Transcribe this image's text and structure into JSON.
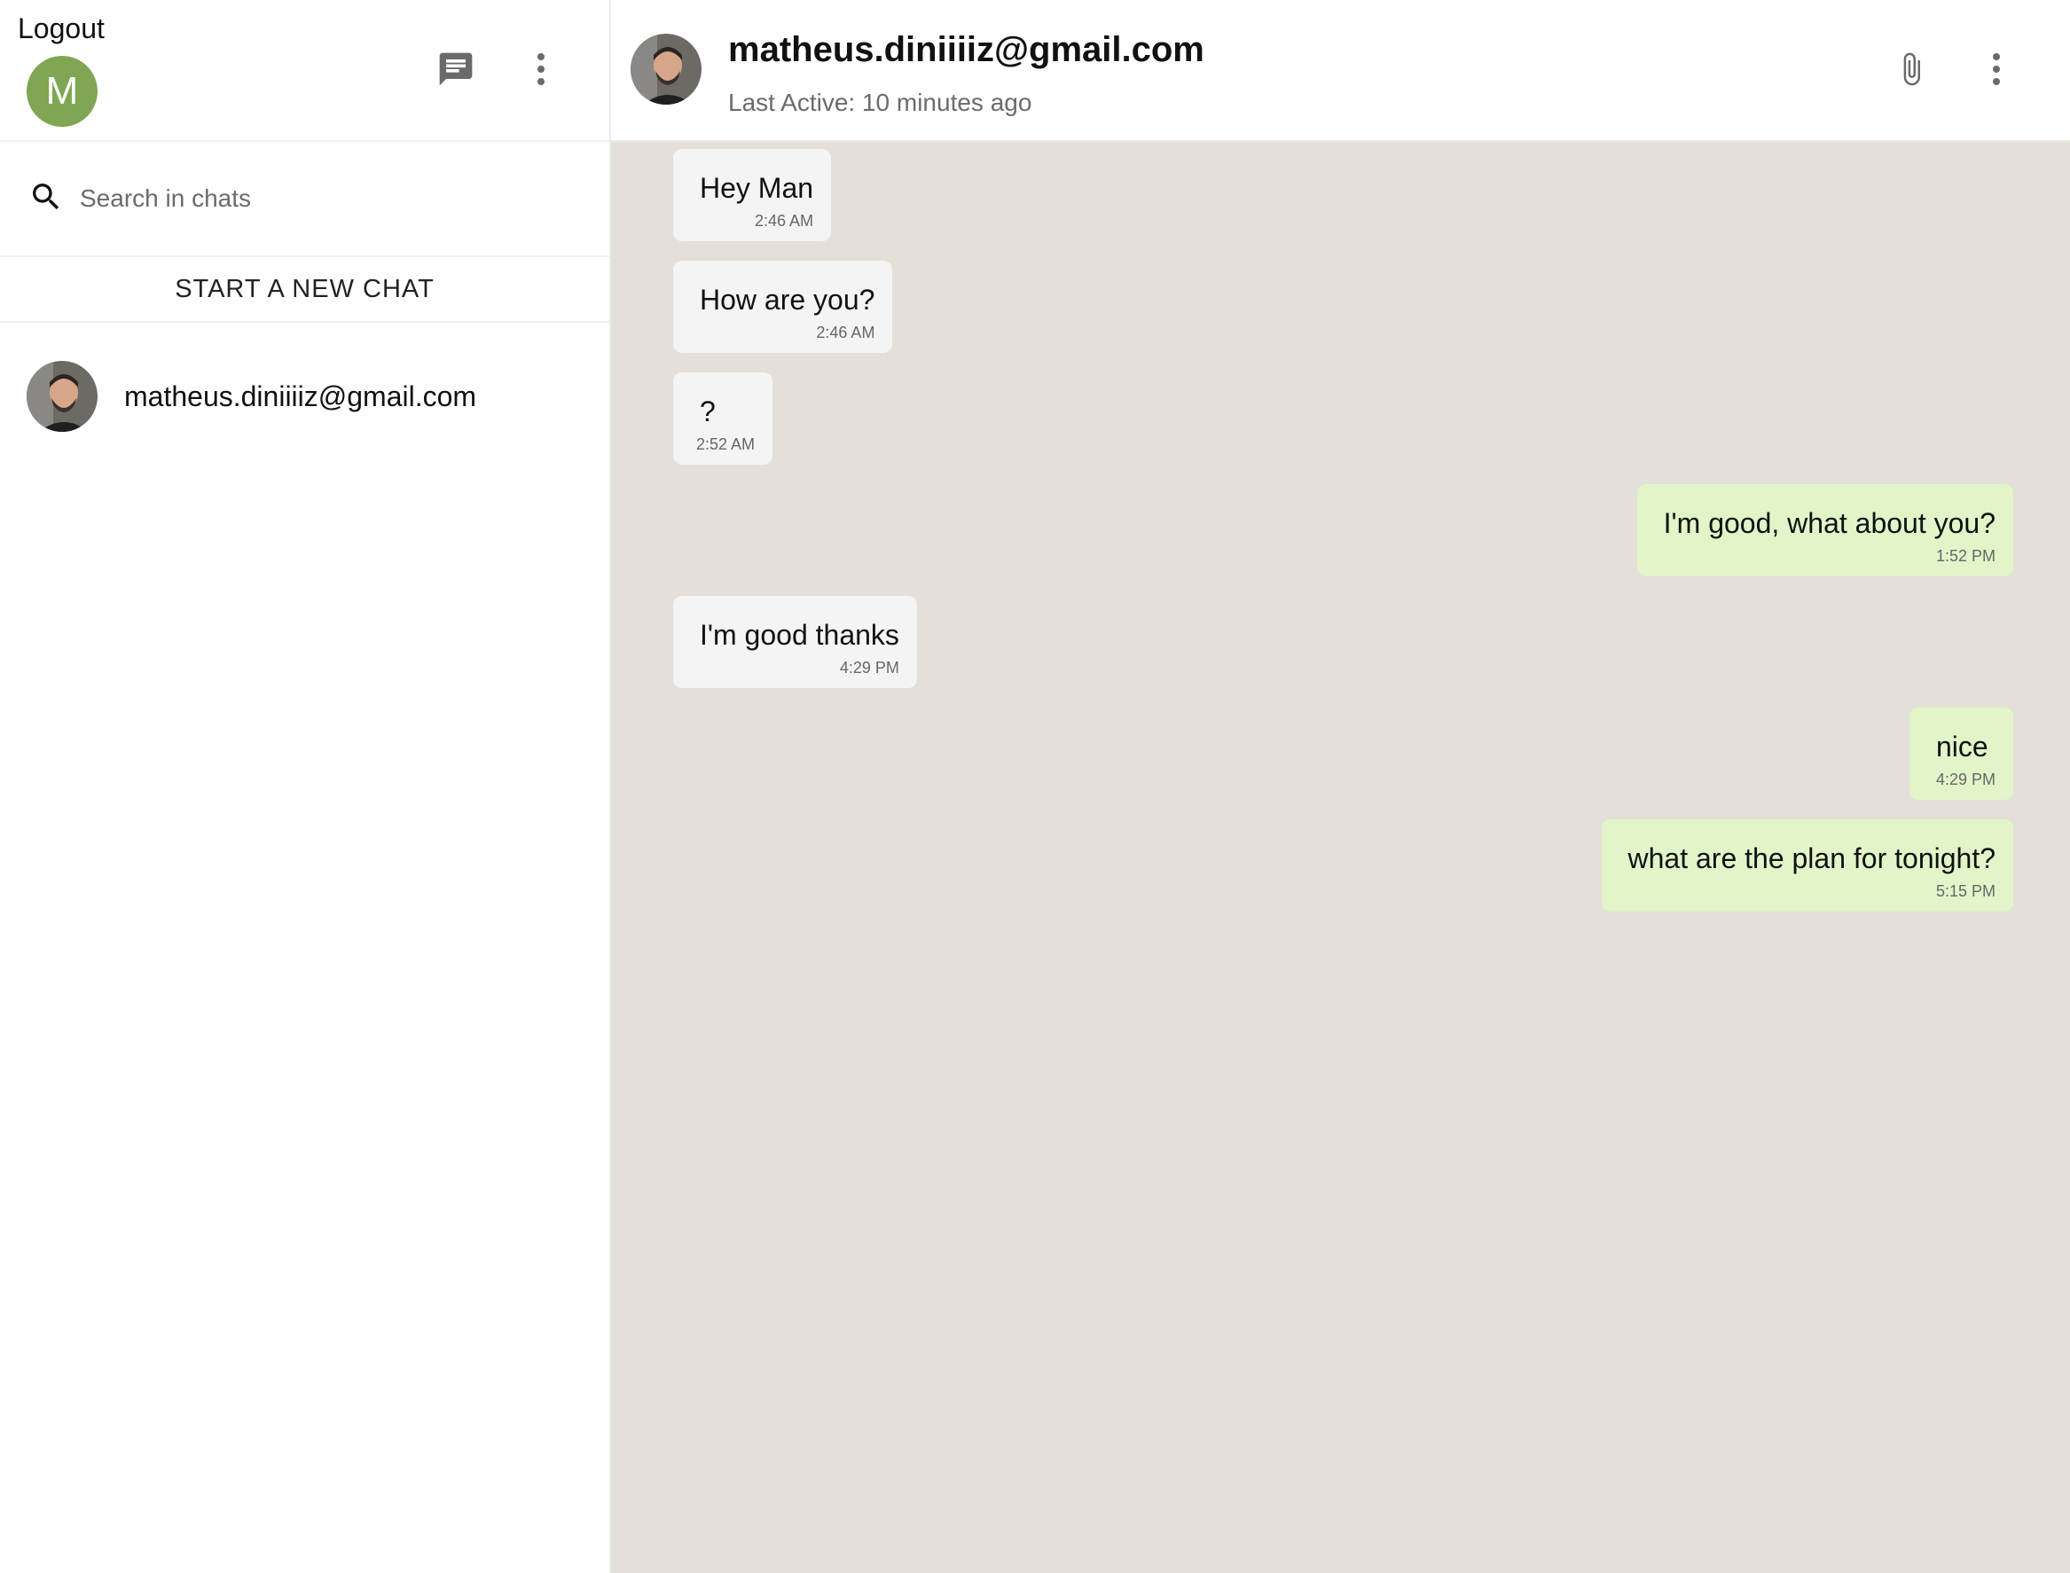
{
  "sidebar": {
    "logout_label": "Logout",
    "user_initial": "M",
    "user_avatar_color": "#7fa652",
    "search_placeholder": "Search in chats",
    "new_chat_label": "START A NEW CHAT",
    "chats": [
      {
        "name": "matheus.diniiiiz@gmail.com"
      }
    ],
    "icons": {
      "new_chat": "chat-bubble-icon",
      "more": "more-vertical-icon",
      "search": "search-icon"
    }
  },
  "chat": {
    "contact_name": "matheus.diniiiiz@gmail.com",
    "status": "Last Active: 10 minutes ago",
    "icons": {
      "attach": "paperclip-icon",
      "more": "more-vertical-icon"
    },
    "messages": [
      {
        "direction": "in",
        "text": "Hey Man",
        "time": "2:46 AM"
      },
      {
        "direction": "in",
        "text": "How are you?",
        "time": "2:46 AM"
      },
      {
        "direction": "in",
        "text": "?",
        "time": "2:52 AM"
      },
      {
        "direction": "out",
        "text": "I'm good, what about you?",
        "time": "1:52 PM"
      },
      {
        "direction": "in",
        "text": "I'm good thanks",
        "time": "4:29 PM"
      },
      {
        "direction": "out",
        "text": "nice",
        "time": "4:29 PM"
      },
      {
        "direction": "out",
        "text": "what are the plan for tonight?",
        "time": "5:15 PM"
      }
    ]
  },
  "colors": {
    "chat_background": "#e4dfd9",
    "incoming_bubble": "#f4f4f4",
    "outgoing_bubble": "#e1f5c9"
  }
}
